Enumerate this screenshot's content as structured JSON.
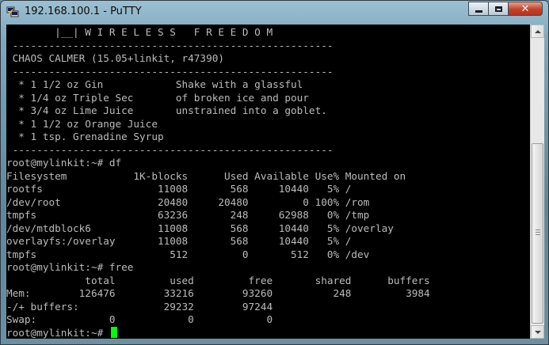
{
  "window": {
    "title": "192.168.100.1 - PuTTY"
  },
  "terminal": {
    "lines": [
      "        |__| W I R E L E S S   F R E E D O M",
      " -----------------------------------------------------",
      " CHAOS CALMER (15.05+linkit, r47390)",
      " -----------------------------------------------------",
      "  * 1 1/2 oz Gin            Shake with a glassful",
      "  * 1/4 oz Triple Sec       of broken ice and pour",
      "  * 3/4 oz Lime Juice       unstrained into a goblet.",
      "  * 1 1/2 oz Orange Juice",
      "  * 1 tsp. Grenadine Syrup",
      " -----------------------------------------------------",
      "root@mylinkit:~# df",
      "Filesystem           1K-blocks      Used Available Use% Mounted on",
      "rootfs                   11008       568     10440   5% /",
      "/dev/root                20480     20480         0 100% /rom",
      "tmpfs                    63236       248     62988   0% /tmp",
      "/dev/mtdblock6           11008       568     10440   5% /overlay",
      "overlayfs:/overlay       11008       568     10440   5% /",
      "tmpfs                      512         0       512   0% /dev",
      "root@mylinkit:~# free",
      "             total         used         free       shared      buffers",
      "Mem:        126476        33216        93260          248         3984",
      "-/+ buffers:              29232        97244",
      "Swap:            0            0            0",
      "root@mylinkit:~# "
    ]
  },
  "colors": {
    "terminal_bg": "#000000",
    "terminal_fg": "#bbbbbb",
    "cursor": "#00ff00"
  }
}
